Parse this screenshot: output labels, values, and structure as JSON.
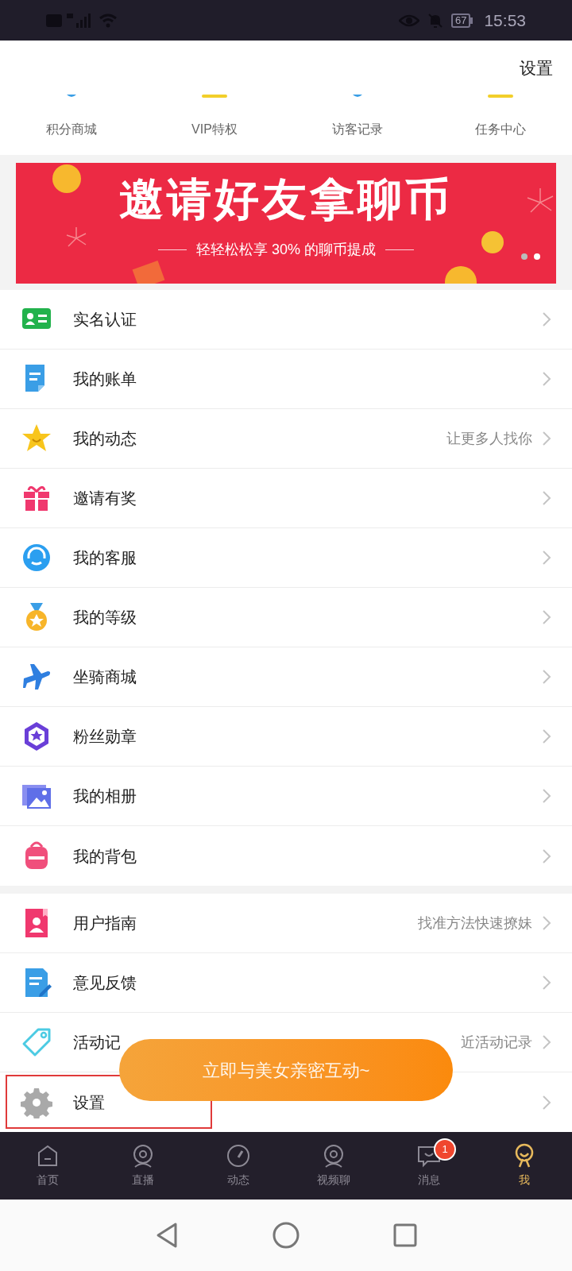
{
  "status_bar": {
    "battery": "67",
    "time": "15:53"
  },
  "header": {
    "settings_link": "设置"
  },
  "shortcuts": [
    {
      "label": "积分商城"
    },
    {
      "label": "VIP特权"
    },
    {
      "label": "访客记录"
    },
    {
      "label": "任务中心"
    }
  ],
  "banner": {
    "title": "邀请好友拿聊币",
    "subtitle": "轻轻松松享 30% 的聊币提成",
    "dots": [
      {
        "selected": false
      },
      {
        "selected": true
      }
    ]
  },
  "menu_groups": [
    {
      "items": [
        {
          "label": "实名认证"
        },
        {
          "label": "我的账单"
        },
        {
          "label": "我的动态",
          "hint": "让更多人找你"
        },
        {
          "label": "邀请有奖"
        },
        {
          "label": "我的客服"
        },
        {
          "label": "我的等级"
        },
        {
          "label": "坐骑商城"
        },
        {
          "label": "粉丝勋章"
        },
        {
          "label": "我的相册"
        },
        {
          "label": "我的背包"
        }
      ]
    },
    {
      "items": [
        {
          "label": "用户指南",
          "hint": "找准方法快速撩妹",
          "highlighted": false
        },
        {
          "label": "意见反馈",
          "highlighted": false
        },
        {
          "label": "活动记",
          "hint": "近活动记录",
          "highlighted": false
        },
        {
          "label": "设置",
          "highlighted": true
        }
      ]
    }
  ],
  "floating_button": {
    "label": "立即与美女亲密互动~"
  },
  "bottom_nav": [
    {
      "label": "首页",
      "selected": false
    },
    {
      "label": "直播",
      "selected": false
    },
    {
      "label": "动态",
      "selected": false
    },
    {
      "label": "视频聊",
      "selected": false
    },
    {
      "label": "消息",
      "selected": false,
      "badge": "1"
    },
    {
      "label": "我",
      "selected": true
    }
  ]
}
